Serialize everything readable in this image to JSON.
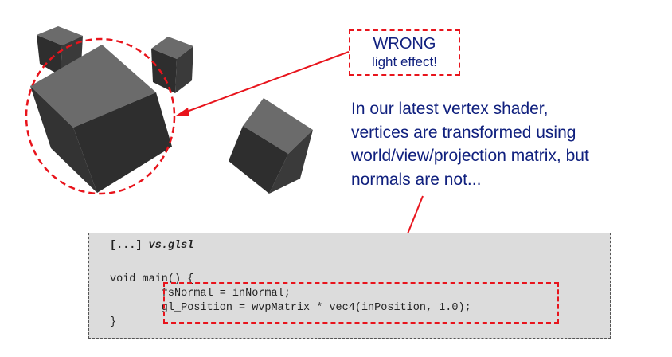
{
  "callout": {
    "line1": "WRONG",
    "line2": "light effect!"
  },
  "description": [
    "In our latest vertex shader,",
    "vertices are transformed using",
    "world/view/projection matrix, but",
    "normals are not..."
  ],
  "code": {
    "header_brackets": "[...]",
    "header_file": "vs.glsl",
    "lines": [
      "void main() {",
      "        fsNormal = inNormal;",
      "        gl_Position = wvpMatrix * vec4(inPosition, 1.0);",
      "}"
    ]
  },
  "colors": {
    "annotation_red": "#e8141c",
    "text_blue": "#10207e",
    "code_bg": "#dcdcdc",
    "cube_top": "#6b6b6b",
    "cube_side": "#3c3c3c",
    "cube_front": "#2e2e2e"
  }
}
